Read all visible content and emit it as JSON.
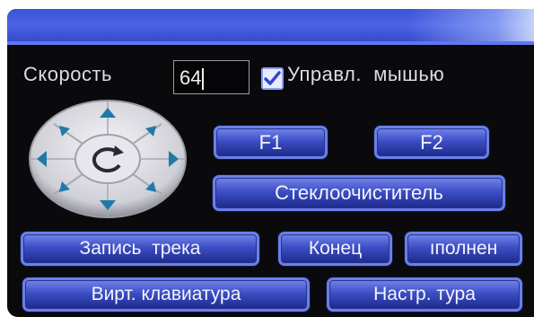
{
  "header": {
    "accent_color": "#4d63e4"
  },
  "speed": {
    "label": "Скорость",
    "value": "64"
  },
  "mouse_control": {
    "label": "Управл.  мышью",
    "checked": true
  },
  "dpad": {
    "icons": [
      "arrow-up-icon",
      "arrow-down-icon",
      "arrow-left-icon",
      "arrow-right-icon",
      "arrow-up-left-icon",
      "arrow-up-right-icon",
      "arrow-down-left-icon",
      "arrow-down-right-icon",
      "rotate-icon"
    ]
  },
  "buttons": {
    "f1": "F1",
    "f2": "F2",
    "wiper": "Стеклоочиститель",
    "record_track": "Запись  трека",
    "end": "Конец",
    "execute": "ıполнен",
    "virtual_keyboard": "Вирт. клавиатура",
    "tour_settings": "Настр. тура"
  }
}
